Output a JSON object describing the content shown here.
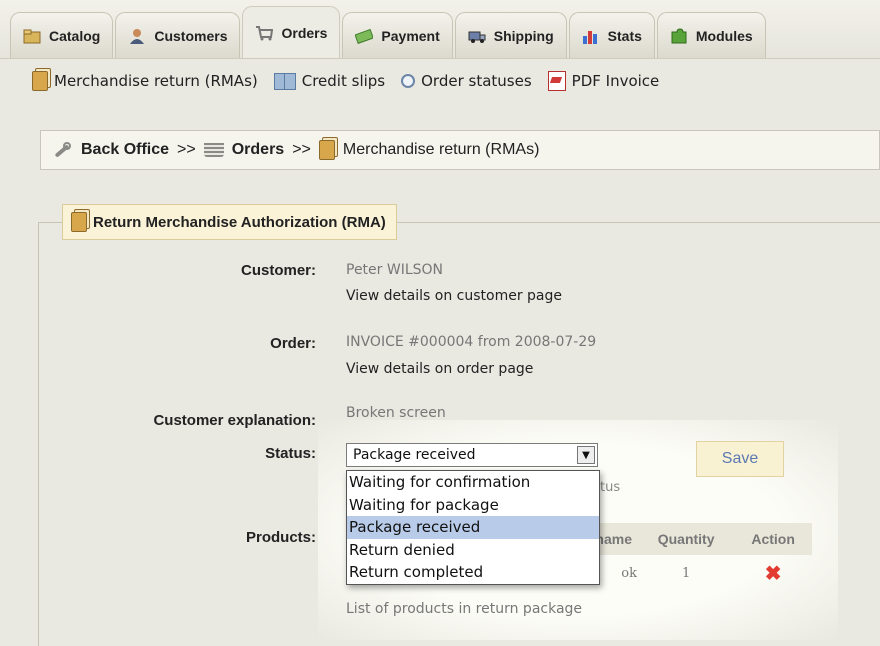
{
  "tabs": [
    {
      "label": "Catalog",
      "icon": "folder-icon"
    },
    {
      "label": "Customers",
      "icon": "user-icon"
    },
    {
      "label": "Orders",
      "icon": "cart-icon",
      "active": true
    },
    {
      "label": "Payment",
      "icon": "money-icon"
    },
    {
      "label": "Shipping",
      "icon": "truck-icon"
    },
    {
      "label": "Stats",
      "icon": "chart-icon"
    },
    {
      "label": "Modules",
      "icon": "puzzle-icon"
    }
  ],
  "subnav": [
    {
      "label": "Merchandise return (RMAs)",
      "icon": "document-icon"
    },
    {
      "label": "Credit slips",
      "icon": "book-icon"
    },
    {
      "label": "Order statuses",
      "icon": "clock-icon"
    },
    {
      "label": "PDF Invoice",
      "icon": "pdf-icon"
    }
  ],
  "breadcrumb": {
    "root": "Back Office",
    "sep": ">>",
    "orders": "Orders",
    "current": "Merchandise return (RMAs)"
  },
  "panel": {
    "title": "Return Merchandise Authorization (RMA)",
    "customer_label": "Customer:",
    "customer_name": "Peter WILSON",
    "customer_link": "View details on customer page",
    "order_label": "Order:",
    "order_value": "INVOICE #000004 from 2008-07-29",
    "order_link": "View details on order page",
    "explanation_label": "Customer explanation:",
    "explanation_value": "Broken screen",
    "status_label": "Status:",
    "status_selected": "Package received",
    "status_options": [
      "Waiting for confirmation",
      "Waiting for package",
      "Package received",
      "Return denied",
      "Return completed"
    ],
    "status_note": "tus",
    "save_label": "Save",
    "products_label": "Products:",
    "products_columns": [
      "name",
      "Quantity",
      "Action"
    ],
    "products_rows": [
      {
        "name": "ok",
        "quantity": "1"
      }
    ],
    "products_caption": "List of products in return package"
  },
  "colors": {
    "background": "#e9e8e1",
    "highlight": "#b8cbe8",
    "save_text": "#5d79b4",
    "delete": "#e23b32"
  }
}
